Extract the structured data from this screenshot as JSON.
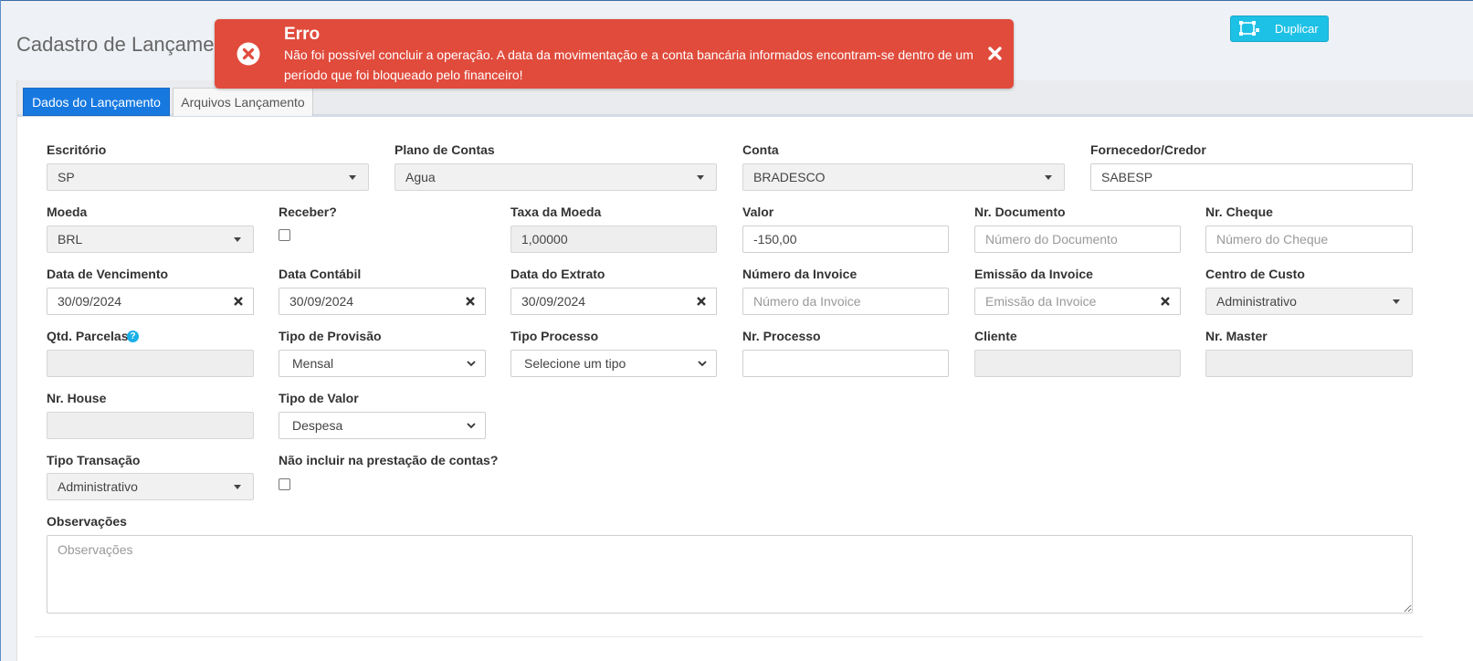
{
  "page": {
    "title": "Cadastro de Lançamento"
  },
  "toolbar": {
    "duplicate_label": "Duplicar"
  },
  "toast": {
    "title": "Erro",
    "message": "Não foi possível concluir a operação. A data da movimentação e a conta bancária informados encontram-se dentro de um período que foi bloqueado pelo financeiro!",
    "color": "#e04b3c"
  },
  "tabs": [
    {
      "label": "Dados do Lançamento",
      "active": true
    },
    {
      "label": "Arquivos Lançamento",
      "active": false
    }
  ],
  "form": {
    "escritorio": {
      "label": "Escritório",
      "value": "SP"
    },
    "plano_contas": {
      "label": "Plano de Contas",
      "value": "Agua"
    },
    "conta": {
      "label": "Conta",
      "value": "BRADESCO"
    },
    "fornecedor": {
      "label": "Fornecedor/Credor",
      "value": "SABESP"
    },
    "moeda": {
      "label": "Moeda",
      "value": "BRL"
    },
    "receber": {
      "label": "Receber?",
      "checked": false
    },
    "taxa_moeda": {
      "label": "Taxa da Moeda",
      "value": "1,00000"
    },
    "valor": {
      "label": "Valor",
      "value": "-150,00"
    },
    "nr_documento": {
      "label": "Nr. Documento",
      "placeholder": "Número do Documento"
    },
    "nr_cheque": {
      "label": "Nr. Cheque",
      "placeholder": "Número do Cheque"
    },
    "data_vencimento": {
      "label": "Data de Vencimento",
      "value": "30/09/2024"
    },
    "data_contabil": {
      "label": "Data Contábil",
      "value": "30/09/2024"
    },
    "data_extrato": {
      "label": "Data do Extrato",
      "value": "30/09/2024"
    },
    "numero_invoice": {
      "label": "Número da Invoice",
      "placeholder": "Número da Invoice"
    },
    "emissao_invoice": {
      "label": "Emissão da Invoice",
      "placeholder": "Emissão da Invoice"
    },
    "centro_custo": {
      "label": "Centro de Custo",
      "value": "Administrativo"
    },
    "qtd_parcelas": {
      "label": "Qtd. Parcelas",
      "value": ""
    },
    "tipo_provisao": {
      "label": "Tipo de Provisão",
      "value": "Mensal"
    },
    "tipo_processo": {
      "label": "Tipo Processo",
      "value": "Selecione um tipo"
    },
    "nr_processo": {
      "label": "Nr. Processo",
      "value": ""
    },
    "cliente": {
      "label": "Cliente",
      "value": ""
    },
    "nr_master": {
      "label": "Nr. Master",
      "value": ""
    },
    "nr_house": {
      "label": "Nr. House",
      "value": ""
    },
    "tipo_valor": {
      "label": "Tipo de Valor",
      "value": "Despesa"
    },
    "tipo_transacao": {
      "label": "Tipo Transação",
      "value": "Administrativo"
    },
    "nao_incluir": {
      "label": "Não incluir na prestação de contas?",
      "checked": false
    },
    "observacoes": {
      "label": "Observações",
      "placeholder": "Observações"
    }
  }
}
